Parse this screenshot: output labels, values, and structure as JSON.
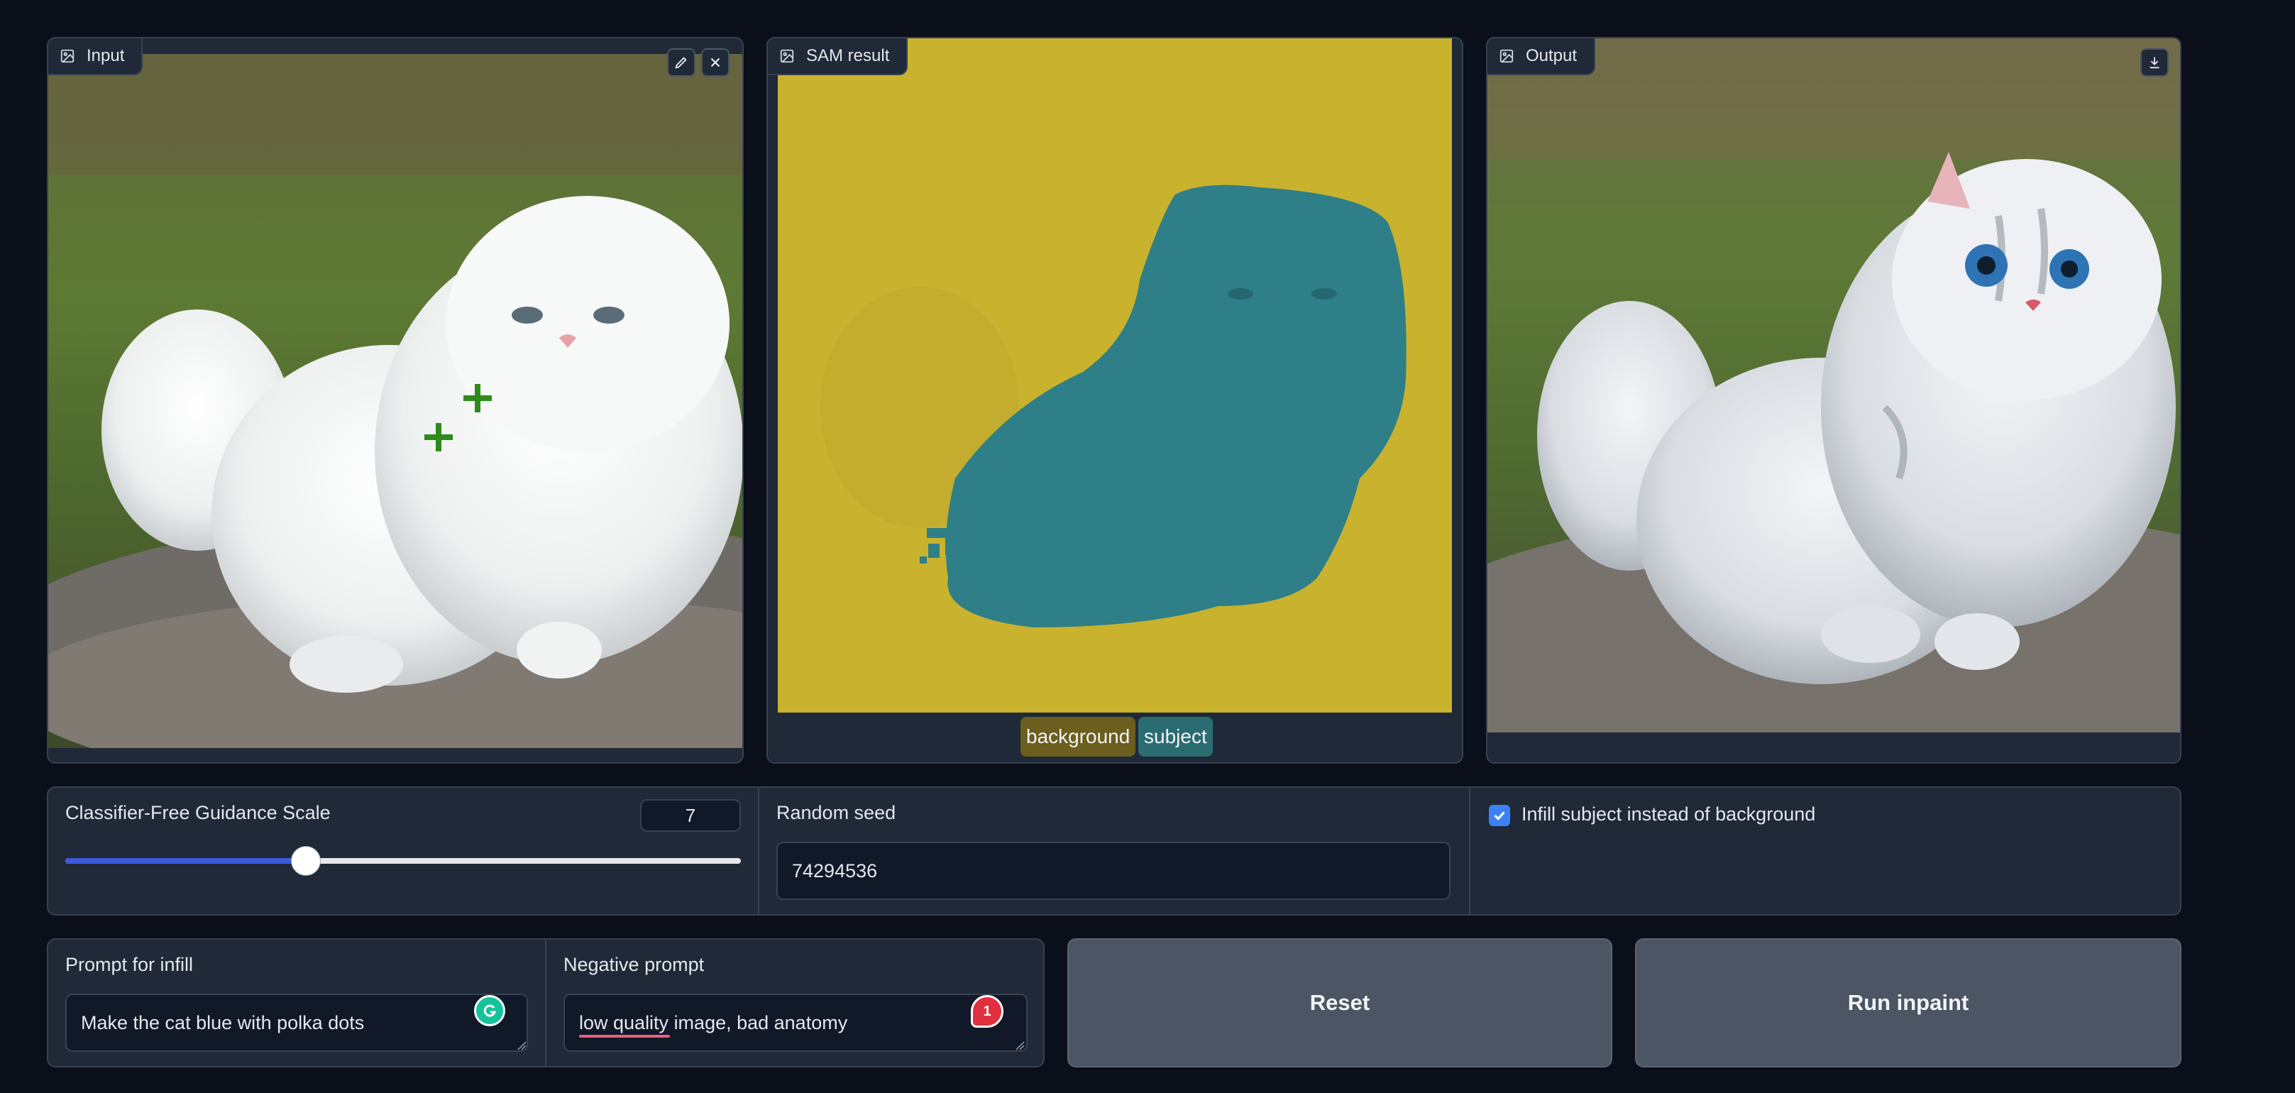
{
  "panels": {
    "input": {
      "label": "Input",
      "edit_icon": "pencil-icon",
      "close_icon": "close-icon"
    },
    "sam": {
      "label": "SAM result",
      "legend": [
        "background",
        "subject"
      ]
    },
    "output": {
      "label": "Output",
      "download_icon": "download-icon"
    }
  },
  "controls": {
    "cfg": {
      "label": "Classifier-Free Guidance Scale",
      "value": "7",
      "slider_fraction": 0.355
    },
    "seed": {
      "label": "Random seed",
      "value": "74294536"
    },
    "infill": {
      "label": "Infill subject instead of background",
      "checked": true
    }
  },
  "prompts": {
    "prompt": {
      "label": "Prompt for infill",
      "value": "Make the cat blue with polka dots"
    },
    "negative": {
      "label": "Negative prompt",
      "value": "low quality image, bad anatomy",
      "notification_count": "1"
    }
  },
  "buttons": {
    "reset": "Reset",
    "run": "Run inpaint"
  },
  "colors": {
    "background_mask": "#c9b22e",
    "subject_mask": "#2e7f88",
    "background_badge": "#6b5e1e",
    "subject_badge": "#2b6c73",
    "slider_accent": "#3b5bdb",
    "checkbox_accent": "#3b82f6"
  }
}
